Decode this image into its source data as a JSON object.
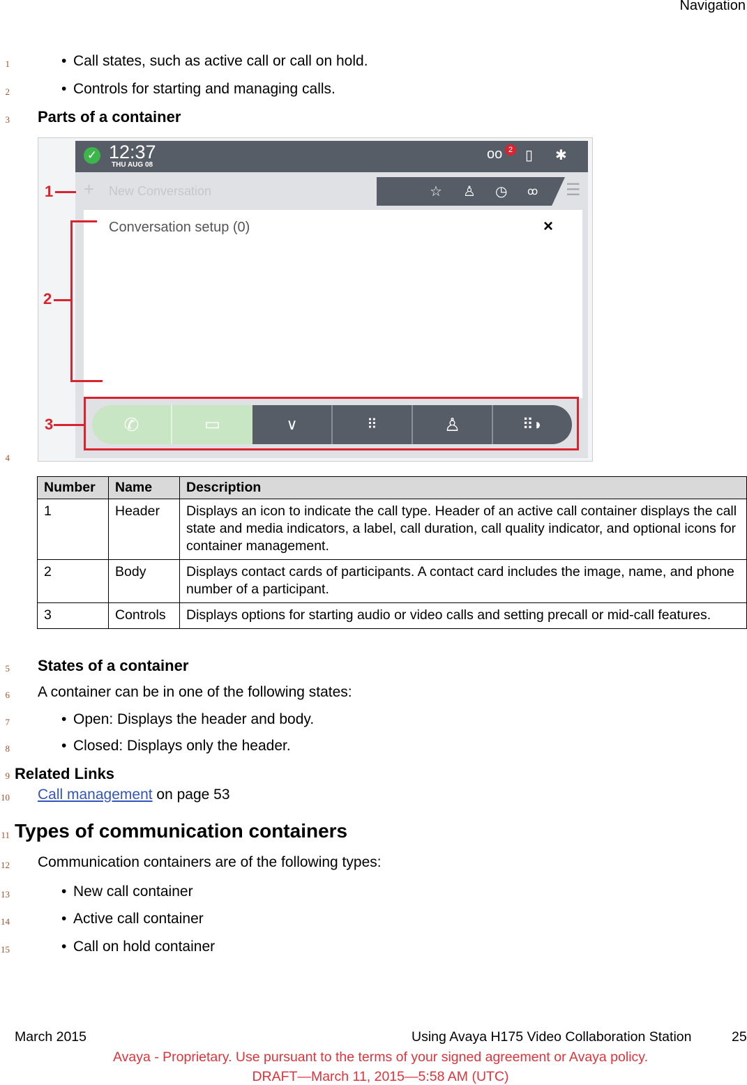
{
  "header": {
    "section": "Navigation"
  },
  "line_numbers": [
    "1",
    "2",
    "3",
    "4",
    "5",
    "6",
    "7",
    "8",
    "9",
    "10",
    "11",
    "12",
    "13",
    "14",
    "15"
  ],
  "intro_bullets": [
    "Call states, such as active call or call on hold.",
    "Controls for starting and managing calls."
  ],
  "parts_heading": "Parts of a container",
  "figure": {
    "time": "12:37",
    "date": "THU AUG 08",
    "badge": "2",
    "new_conversation": "New Conversation",
    "body_title": "Conversation setup (0)",
    "close": "×",
    "callouts": [
      "1",
      "2",
      "3"
    ],
    "icons": [
      "check-circle-icon",
      "voicemail-icon",
      "phone-transfer-icon",
      "bluetooth-icon",
      "star-icon",
      "contact-icon",
      "clock-icon",
      "group-icon",
      "menu-icon",
      "phone-icon",
      "video-icon",
      "chevron-down-icon",
      "dialpad-icon",
      "person-icon",
      "dialpad-redial-icon"
    ],
    "colors": {
      "bar": "#565d67",
      "accent": "#d9232e",
      "call_green": "#c8e6c4",
      "check": "#3cb54a"
    }
  },
  "table": {
    "headers": [
      "Number",
      "Name",
      "Description"
    ],
    "rows": [
      [
        "1",
        "Header",
        "Displays an icon to indicate the call type. Header of an active call container displays the call state and media indicators, a label, call duration, call quality indicator, and optional icons for container management."
      ],
      [
        "2",
        "Body",
        "Displays contact cards of participants. A contact card includes the image, name, and phone number of a participant."
      ],
      [
        "3",
        "Controls",
        "Displays options for starting audio or video calls and setting precall or mid-call features."
      ]
    ]
  },
  "states": {
    "heading": "States of a container",
    "intro": "A container can be in one of the following states:",
    "bullets": [
      "Open: Displays the header and body.",
      "Closed: Displays only the header."
    ]
  },
  "related": {
    "heading": "Related Links",
    "link": "Call management",
    "suffix": " on page 53"
  },
  "types": {
    "heading": "Types of communication containers",
    "intro": "Communication containers are of the following types:",
    "bullets": [
      "New call container",
      "Active call container",
      "Call on hold container"
    ]
  },
  "footer": {
    "date": "March 2015",
    "title": "Using Avaya H175 Video Collaboration Station",
    "page": "25",
    "proprietary": "Avaya - Proprietary. Use pursuant to the terms of your signed agreement or Avaya policy.",
    "draft": "DRAFT—March 11, 2015—5:58 AM (UTC)"
  }
}
